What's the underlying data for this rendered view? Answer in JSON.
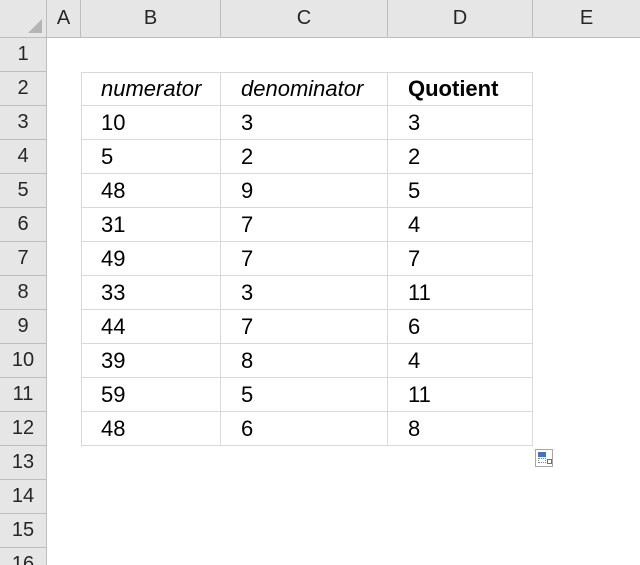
{
  "columns": [
    "A",
    "B",
    "C",
    "D",
    "E"
  ],
  "rows": [
    "1",
    "2",
    "3",
    "4",
    "5",
    "6",
    "7",
    "8",
    "9",
    "10",
    "11",
    "12",
    "13",
    "14",
    "15",
    "16"
  ],
  "table": {
    "headers": {
      "numerator": "numerator",
      "denominator": "denominator",
      "quotient": "Quotient"
    },
    "data": [
      {
        "numerator": "10",
        "denominator": "3",
        "quotient": "3"
      },
      {
        "numerator": "5",
        "denominator": "2",
        "quotient": "2"
      },
      {
        "numerator": "48",
        "denominator": "9",
        "quotient": "5"
      },
      {
        "numerator": "31",
        "denominator": "7",
        "quotient": "4"
      },
      {
        "numerator": "49",
        "denominator": "7",
        "quotient": "7"
      },
      {
        "numerator": "33",
        "denominator": "3",
        "quotient": "11"
      },
      {
        "numerator": "44",
        "denominator": "7",
        "quotient": "6"
      },
      {
        "numerator": "39",
        "denominator": "8",
        "quotient": "4"
      },
      {
        "numerator": "59",
        "denominator": "5",
        "quotient": "11"
      },
      {
        "numerator": "48",
        "denominator": "6",
        "quotient": "8"
      }
    ]
  },
  "paste_options": {
    "icon": "paste-options-icon"
  }
}
